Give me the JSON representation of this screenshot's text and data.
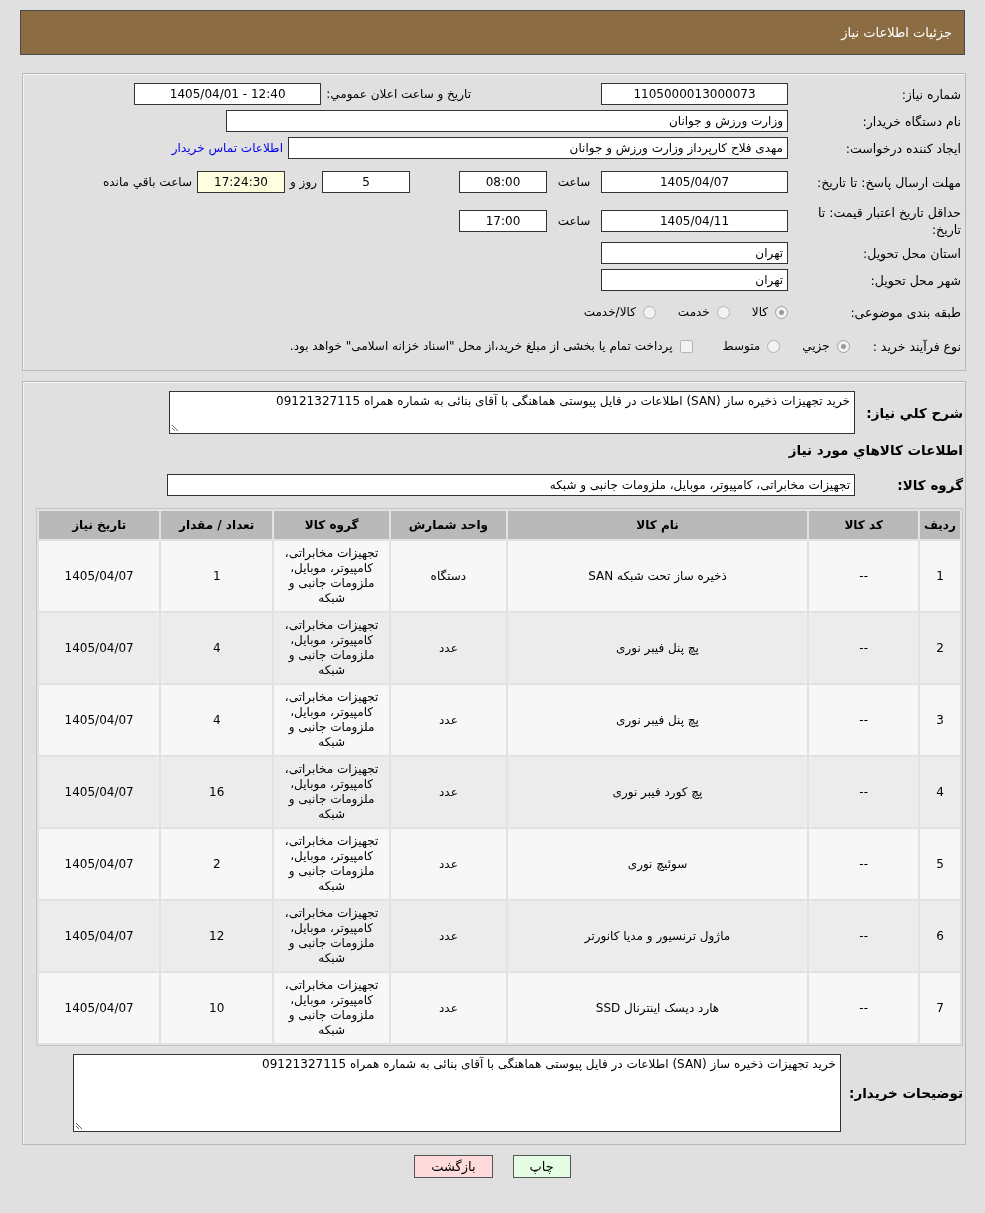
{
  "header": {
    "title": "جزئیات اطلاعات نیاز"
  },
  "details": {
    "need_number": {
      "label": "شماره نیاز:",
      "value": "1105000013000073"
    },
    "announce": {
      "label": "تاریخ و ساعت اعلان عمومي:",
      "value": "1405/04/01 - 12:40"
    },
    "buyer": {
      "label": "نام دستگاه خریدار:",
      "value": "وزارت ورزش و جوانان"
    },
    "requester": {
      "label": "ایجاد کننده درخواست:",
      "value": "مهدی فلاح کارپرداز وزارت ورزش و جوانان",
      "contact_link": "اطلاعات تماس خریدار"
    },
    "reply_deadline": {
      "label": "مهلت ارسال پاسخ: تا تاریخ:",
      "date": "1405/04/07",
      "time_label": "ساعت",
      "time": "08:00",
      "days": "5",
      "days_label": "روز و",
      "remaining": "17:24:30",
      "remaining_label": "ساعت باقي مانده"
    },
    "price_validity": {
      "label": "حداقل تاریخ اعتبار قیمت: تا تاریخ:",
      "date": "1405/04/11",
      "time_label": "ساعت",
      "time": "17:00"
    },
    "province": {
      "label": "استان محل تحویل:",
      "value": "تهران"
    },
    "city": {
      "label": "شهر محل تحویل:",
      "value": "تهران"
    },
    "category": {
      "label": "طبقه بندی موضوعی:",
      "options": [
        {
          "label": "کالا",
          "selected": true
        },
        {
          "label": "خدمت",
          "selected": false
        },
        {
          "label": "کالا/خدمت",
          "selected": false
        }
      ]
    },
    "process": {
      "label": "نوع فرآیند خرید :",
      "options": [
        {
          "label": "جزيي",
          "selected": true
        },
        {
          "label": "متوسط",
          "selected": false
        }
      ],
      "treasury": {
        "label": "پرداخت تمام یا بخشی از مبلغ خرید،از محل \"اسناد خزانه اسلامی\" خواهد بود.",
        "checked": false
      }
    }
  },
  "needs": {
    "description": {
      "label": "شرح کلي نیاز:",
      "value": "خرید تجهیزات ذخیره ساز (SAN) اطلاعات در فایل پیوستی هماهنگی با آقای بنائی به شماره همراه 09121327115"
    },
    "items_heading": "اطلاعات کالاهاي مورد نیاز",
    "group": {
      "label": "گروه کالا:",
      "value": "تجهیزات مخابراتی، کامپیوتر، موبایل، ملزومات جانبی و شبکه"
    },
    "table": {
      "columns": [
        "ردیف",
        "کد کالا",
        "نام کالا",
        "واحد شمارش",
        "گروه کالا",
        "تعداد / مقدار",
        "تاریخ نیاز"
      ],
      "rows": [
        {
          "row_number": "1",
          "item_code": "--",
          "item_name": "ذخیره ساز تحت شبکه SAN",
          "unit": "دستگاه",
          "item_group": "تجهیزات مخابراتی، کامپیوتر، موبایل، ملزومات جانبی و شبکه",
          "quantity": "1",
          "need_date": "1405/04/07"
        },
        {
          "row_number": "2",
          "item_code": "--",
          "item_name": "پچ پنل فیبر نوری",
          "unit": "عدد",
          "item_group": "تجهیزات مخابراتی، کامپیوتر، موبایل، ملزومات جانبی و شبکه",
          "quantity": "4",
          "need_date": "1405/04/07"
        },
        {
          "row_number": "3",
          "item_code": "--",
          "item_name": "پچ پنل فیبر نوری",
          "unit": "عدد",
          "item_group": "تجهیزات مخابراتی، کامپیوتر، موبایل، ملزومات جانبی و شبکه",
          "quantity": "4",
          "need_date": "1405/04/07"
        },
        {
          "row_number": "4",
          "item_code": "--",
          "item_name": "پچ کورد فیبر نوری",
          "unit": "عدد",
          "item_group": "تجهیزات مخابراتی، کامپیوتر، موبایل، ملزومات جانبی و شبکه",
          "quantity": "16",
          "need_date": "1405/04/07"
        },
        {
          "row_number": "5",
          "item_code": "--",
          "item_name": "سوئیچ نوری",
          "unit": "عدد",
          "item_group": "تجهیزات مخابراتی، کامپیوتر، موبایل، ملزومات جانبی و شبکه",
          "quantity": "2",
          "need_date": "1405/04/07"
        },
        {
          "row_number": "6",
          "item_code": "--",
          "item_name": "ماژول ترنسیور و مدیا کانورتر",
          "unit": "عدد",
          "item_group": "تجهیزات مخابراتی، کامپیوتر، موبایل، ملزومات جانبی و شبکه",
          "quantity": "12",
          "need_date": "1405/04/07"
        },
        {
          "row_number": "7",
          "item_code": "--",
          "item_name": "هارد دیسک اینترنال SSD",
          "unit": "عدد",
          "item_group": "تجهیزات مخابراتی، کامپیوتر، موبایل، ملزومات جانبی و شبکه",
          "quantity": "10",
          "need_date": "1405/04/07"
        }
      ]
    },
    "buyer_notes": {
      "label": "توضیحات خریدار:",
      "value": "خرید تجهیزات ذخیره ساز (SAN) اطلاعات در فایل پیوستی هماهنگی با آقای بنائی به شماره همراه 09121327115"
    }
  },
  "buttons": [
    {
      "label": "چاپ",
      "kind": "print"
    },
    {
      "label": "بازگشت",
      "kind": "back"
    }
  ]
}
